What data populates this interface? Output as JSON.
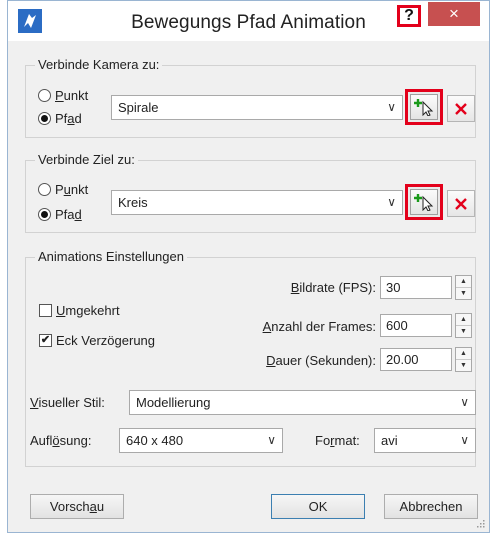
{
  "window": {
    "title": "Bewegungs Pfad Animation",
    "help_label": "?",
    "close_label": "×"
  },
  "camera": {
    "group_label": "Verbinde Kamera zu:",
    "radio_point": {
      "pre": "",
      "key": "P",
      "post": "unkt"
    },
    "radio_path": {
      "pre": "Pf",
      "key": "a",
      "post": "d"
    },
    "selected": "path",
    "path_value": "Spirale"
  },
  "target": {
    "group_label": "Verbinde Ziel zu:",
    "radio_point": {
      "pre": "P",
      "key": "u",
      "post": "nkt"
    },
    "radio_path": {
      "pre": "Pfa",
      "key": "d",
      "post": ""
    },
    "selected": "path",
    "path_value": "Kreis"
  },
  "anim": {
    "group_label": "Animations Einstellungen",
    "reverse": {
      "pre": "",
      "key": "U",
      "post": "mgekehrt",
      "checked": false
    },
    "corner_delay": {
      "label": "Eck Verzögerung",
      "checked": true,
      "mark": "✔"
    },
    "framerate": {
      "pre": "",
      "key": "B",
      "post": "ildrate (FPS):",
      "value": "30"
    },
    "frames": {
      "pre": "",
      "key": "A",
      "post": "nzahl der Frames:",
      "value": "600"
    },
    "duration": {
      "pre": "",
      "key": "D",
      "post": "auer (Sekunden):",
      "value": "20.00"
    },
    "style": {
      "pre": "",
      "key": "V",
      "post": "isueller Stil:",
      "value": "Modellierung"
    },
    "resolution": {
      "pre": "Aufl",
      "key": "ö",
      "post": "sung:",
      "value": "640 x 480"
    },
    "format": {
      "pre": "Fo",
      "key": "r",
      "post": "mat:",
      "value": "avi"
    }
  },
  "buttons": {
    "preview": {
      "pre": "Vorsch",
      "key": "a",
      "post": "u"
    },
    "ok": "OK",
    "cancel": "Abbrechen"
  },
  "colors": {
    "highlight": "#e3001b",
    "delete": "#e3001b",
    "pick_plus": "#1a9a1a",
    "app_icon": "#2b6cc4",
    "close_bg": "#c75050"
  },
  "icons": {
    "pick": "plus-pointer-icon",
    "delete": "red-x-icon",
    "dropdown": "chevron-down-icon",
    "spin_up": "triangle-up-icon",
    "spin_down": "triangle-down-icon"
  }
}
